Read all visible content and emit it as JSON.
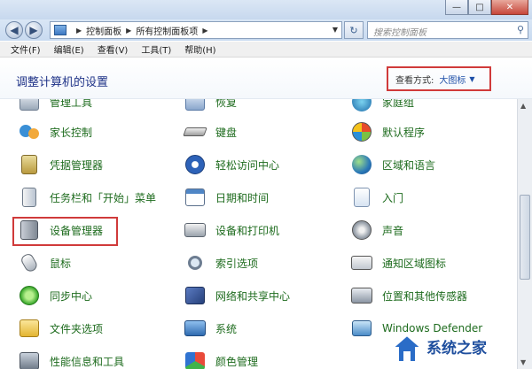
{
  "window": {
    "minimize_glyph": "—",
    "maximize_glyph": "□",
    "close_glyph": "✕"
  },
  "navigation": {
    "back_glyph": "◀",
    "forward_glyph": "▶",
    "breadcrumbs": [
      "控制面板",
      "所有控制面板项"
    ],
    "refresh_glyph": "↻",
    "search_placeholder": "搜索控制面板"
  },
  "menu": {
    "items": [
      "文件(F)",
      "编辑(E)",
      "查看(V)",
      "工具(T)",
      "帮助(H)"
    ]
  },
  "header": {
    "title": "调整计算机的设置",
    "view_label": "查看方式:",
    "view_value": "大图标",
    "view_arrow": "▼"
  },
  "items": [
    {
      "label": "管理工具",
      "icon": "admin-tools-icon"
    },
    {
      "label": "恢复",
      "icon": "recovery-icon"
    },
    {
      "label": "家庭组",
      "icon": "homegroup-icon"
    },
    {
      "label": "家长控制",
      "icon": "parental-controls-icon"
    },
    {
      "label": "键盘",
      "icon": "keyboard-icon"
    },
    {
      "label": "默认程序",
      "icon": "default-programs-icon"
    },
    {
      "label": "凭据管理器",
      "icon": "credential-manager-icon"
    },
    {
      "label": "轻松访问中心",
      "icon": "ease-of-access-icon"
    },
    {
      "label": "区域和语言",
      "icon": "region-language-icon"
    },
    {
      "label": "任务栏和「开始」菜单",
      "icon": "taskbar-icon"
    },
    {
      "label": "日期和时间",
      "icon": "date-time-icon"
    },
    {
      "label": "入门",
      "icon": "getting-started-icon"
    },
    {
      "label": "设备管理器",
      "icon": "device-manager-icon"
    },
    {
      "label": "设备和打印机",
      "icon": "devices-printers-icon"
    },
    {
      "label": "声音",
      "icon": "sound-icon"
    },
    {
      "label": "鼠标",
      "icon": "mouse-icon"
    },
    {
      "label": "索引选项",
      "icon": "indexing-options-icon"
    },
    {
      "label": "通知区域图标",
      "icon": "notification-area-icon"
    },
    {
      "label": "同步中心",
      "icon": "sync-center-icon"
    },
    {
      "label": "网络和共享中心",
      "icon": "network-sharing-icon"
    },
    {
      "label": "位置和其他传感器",
      "icon": "location-sensors-icon"
    },
    {
      "label": "文件夹选项",
      "icon": "folder-options-icon"
    },
    {
      "label": "系统",
      "icon": "system-icon"
    },
    {
      "label": "Windows Defender",
      "icon": "defender-icon"
    },
    {
      "label": "性能信息和工具",
      "icon": "performance-icon"
    },
    {
      "label": "颜色管理",
      "icon": "color-management-icon"
    }
  ],
  "watermark": {
    "text": "系统之家"
  },
  "colors": {
    "link_green": "#1d6b1d",
    "title_blue": "#1e3287",
    "highlight_red": "#d03a3a"
  }
}
